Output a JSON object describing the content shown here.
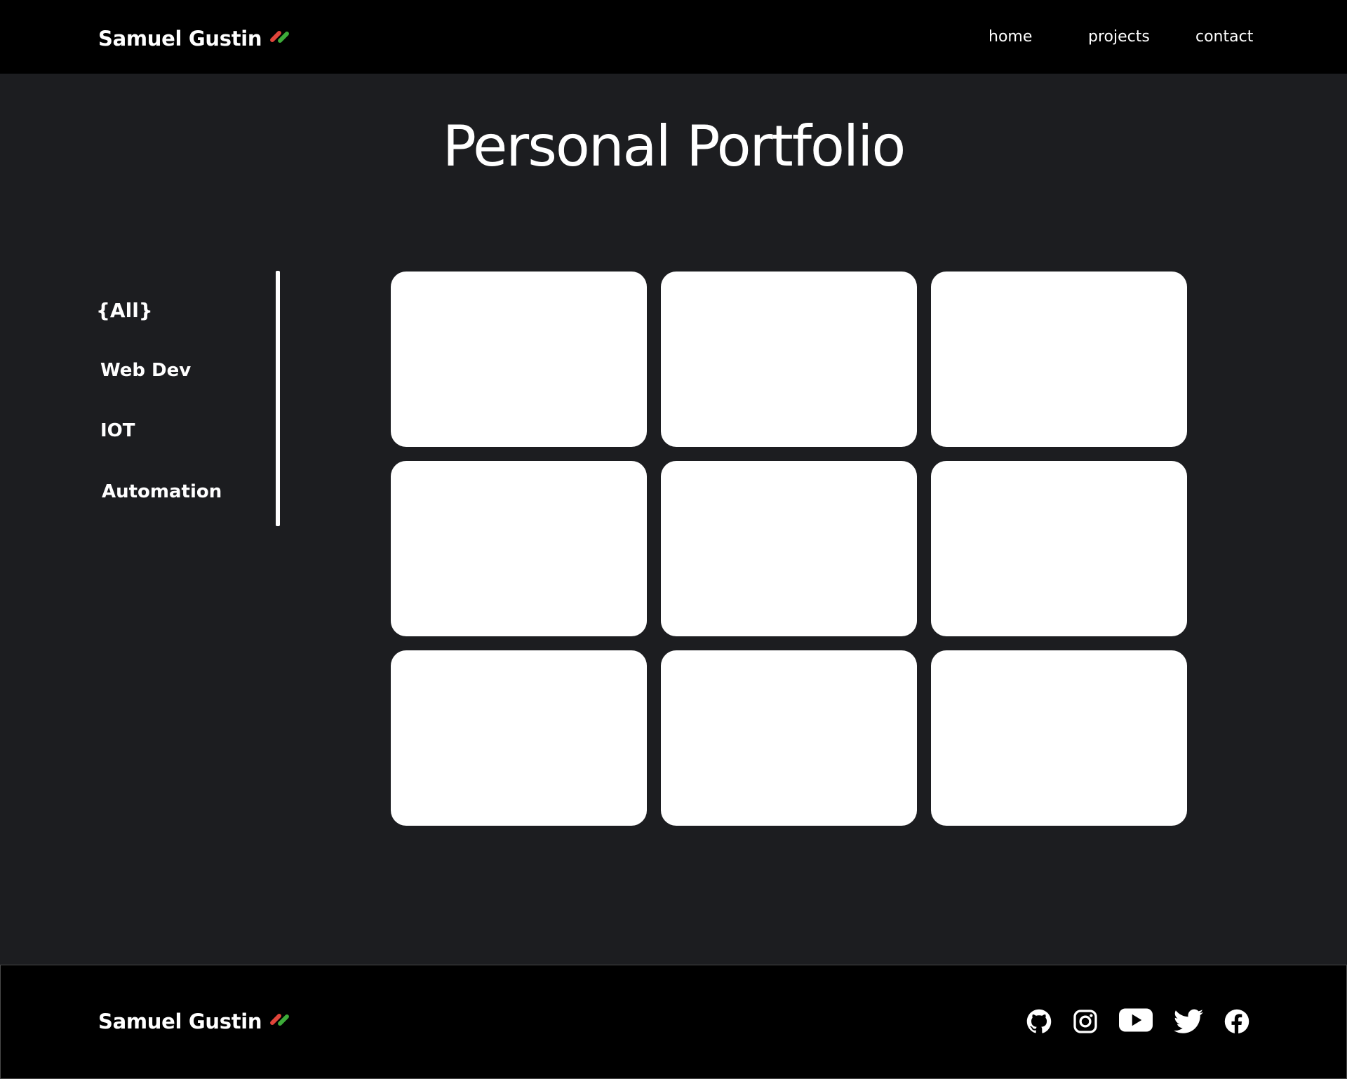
{
  "header": {
    "brand": "Samuel Gustin",
    "nav": [
      {
        "label": "home"
      },
      {
        "label": "projects"
      },
      {
        "label": "contact"
      }
    ]
  },
  "main": {
    "title": "Personal Portfolio",
    "filters": [
      {
        "label": "{All}",
        "active": true
      },
      {
        "label": "Web Dev"
      },
      {
        "label": "IOT"
      },
      {
        "label": "Automation"
      }
    ],
    "cards_count_note": "",
    "cards": [
      {},
      {},
      {},
      {},
      {},
      {},
      {},
      {},
      {}
    ]
  },
  "footer": {
    "brand": "Samuel Gustin",
    "social": [
      {
        "icon": "github-icon"
      },
      {
        "icon": "instagram-icon"
      },
      {
        "icon": "youtube-icon"
      },
      {
        "icon": "twitter-icon"
      },
      {
        "icon": "facebook-icon"
      }
    ]
  },
  "colors": {
    "background": "#1c1d20",
    "bar": "#000000",
    "card": "#ffffff",
    "accent_red": "#e0453a",
    "accent_green": "#3dab39"
  }
}
